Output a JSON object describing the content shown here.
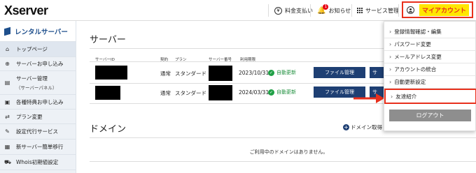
{
  "header": {
    "logo": "Xserver",
    "billing_label": "料金支払い",
    "news_label": "お知らせ",
    "news_count": "1",
    "server_mgmt_label": "サービス管理",
    "account_label": "マイアカウント"
  },
  "sidebar": {
    "title": "レンタルサーバー",
    "items": [
      {
        "icon": "home-icon",
        "label": "トップページ"
      },
      {
        "icon": "plus-circle-icon",
        "label": "サーバーお申し込み"
      },
      {
        "icon": "server-icon",
        "label": "サーバー管理",
        "sub": "（サーバーパネル）"
      },
      {
        "icon": "gift-icon",
        "label": "各種特典お申し込み"
      },
      {
        "icon": "swap-icon",
        "label": "プラン変更"
      },
      {
        "icon": "wrench-icon",
        "label": "設定代行サービス"
      },
      {
        "icon": "building-icon",
        "label": "新サーバー簡単移行"
      },
      {
        "icon": "cart-icon",
        "label": "Whois初期値設定"
      }
    ]
  },
  "server_section": {
    "title": "サーバー",
    "headers": {
      "server_id": "サーバーID",
      "contract": "契約",
      "plan": "プラン",
      "server_no": "サーバー番号",
      "expiry": "利用期限"
    },
    "rows": [
      {
        "contract": "通常",
        "plan": "スタンダード",
        "expiry": "2023/10/31",
        "auto": "自動更新",
        "file_btn": "ファイル管理",
        "srv_btn": "サ"
      },
      {
        "contract": "通常",
        "plan": "スタンダード",
        "expiry": "2024/03/31",
        "auto": "自動更新",
        "file_btn": "ファイル管理",
        "srv_btn": "サ"
      }
    ]
  },
  "domain_section": {
    "title": "ドメイン",
    "get_label": "ドメイン取得",
    "empty_message": "ご利用中のドメインはありません。"
  },
  "account_menu": {
    "items": [
      "登録情報確認・編集",
      "パスワード変更",
      "メールアドレス変更",
      "アカウントの統合",
      "自動更新設定",
      "友達紹介"
    ],
    "logout_label": "ログアウト"
  },
  "colors": {
    "accent_red": "#e8301c",
    "highlight_yellow": "#ffe600",
    "navy": "#1e3f73",
    "green": "#1fa046"
  }
}
